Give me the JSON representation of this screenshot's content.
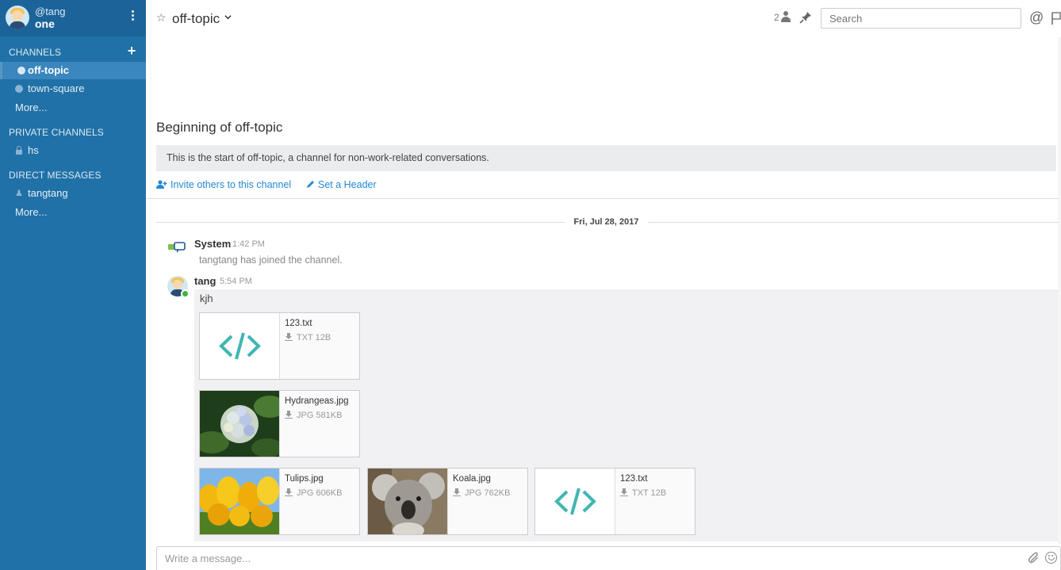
{
  "user": {
    "handle": "@tang",
    "team_name": "one"
  },
  "sidebar": {
    "channels_title": "CHANNELS",
    "channels": [
      {
        "label": "off-topic",
        "active": true
      },
      {
        "label": "town-square",
        "active": false
      }
    ],
    "channels_more": "More...",
    "private_title": "PRIVATE CHANNELS",
    "private_channels": [
      {
        "label": "hs"
      }
    ],
    "dm_title": "DIRECT MESSAGES",
    "direct_messages": [
      {
        "label": "tangtang"
      }
    ],
    "dm_more": "More..."
  },
  "header": {
    "channel_name": "off-topic",
    "member_count": "2",
    "search_placeholder": "Search"
  },
  "intro": {
    "title": "Beginning of off-topic",
    "description": "This is the start of off-topic, a channel for non-work-related conversations.",
    "invite_label": "Invite others to this channel",
    "set_header_label": "Set a Header"
  },
  "date_separator": "Fri, Jul 28, 2017",
  "posts": [
    {
      "author": "System",
      "time": "1:42 PM",
      "message": "tangtang has joined the channel."
    },
    {
      "author": "tang",
      "time": "5:54 PM",
      "message": "kjh"
    }
  ],
  "files": [
    {
      "name": "123.txt",
      "meta": "TXT 12B",
      "kind": "code"
    },
    {
      "name": "Hydrangeas.jpg",
      "meta": "JPG 581KB",
      "kind": "image"
    },
    {
      "name": "Tulips.jpg",
      "meta": "JPG 606KB",
      "kind": "image"
    },
    {
      "name": "Koala.jpg",
      "meta": "JPG 762KB",
      "kind": "image"
    },
    {
      "name": "123.txt",
      "meta": "TXT 12B",
      "kind": "code"
    }
  ],
  "composer": {
    "placeholder": "Write a message..."
  },
  "colors": {
    "sidebar": "#2071a7",
    "sidebar_header": "#1b649a",
    "link": "#2389d7",
    "online": "#3db53d",
    "code_icon": "#3fb6b2"
  }
}
